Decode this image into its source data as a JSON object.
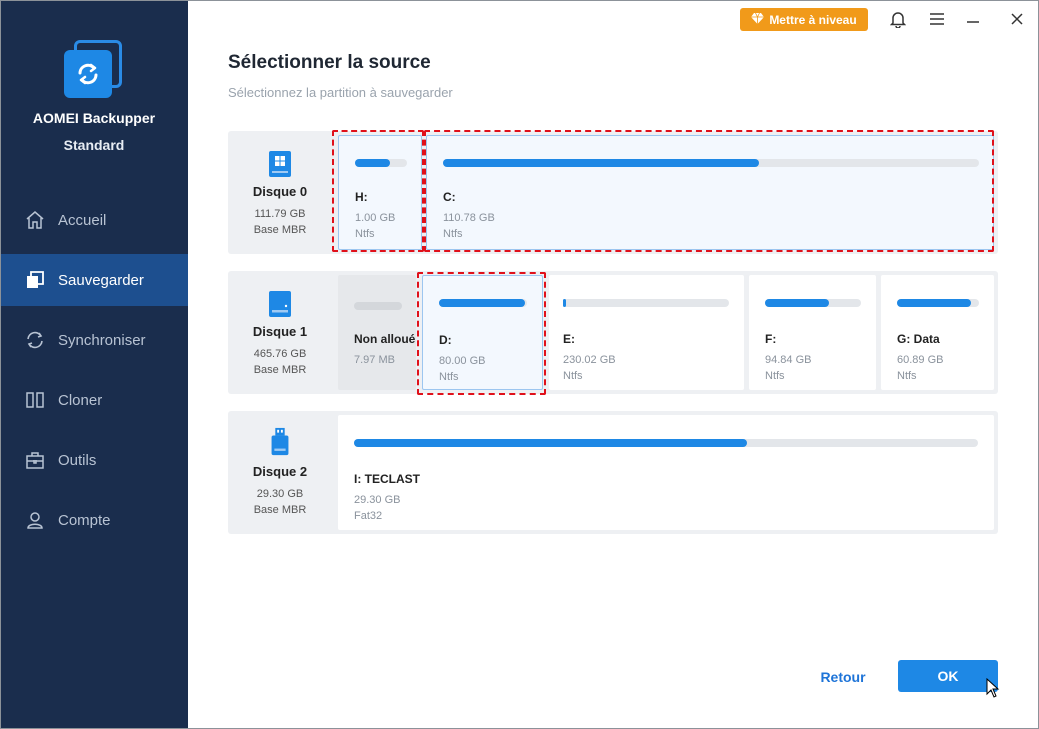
{
  "app": {
    "name": "AOMEI Backupper",
    "edition": "Standard"
  },
  "sidebar": {
    "items": [
      {
        "label": "Accueil",
        "icon": "home-icon"
      },
      {
        "label": "Sauvegarder",
        "icon": "backup-icon",
        "active": true
      },
      {
        "label": "Synchroniser",
        "icon": "sync-icon"
      },
      {
        "label": "Cloner",
        "icon": "clone-icon"
      },
      {
        "label": "Outils",
        "icon": "toolbox-icon"
      },
      {
        "label": "Compte",
        "icon": "user-icon"
      }
    ]
  },
  "topbar": {
    "upgrade_label": "Mettre à niveau"
  },
  "main": {
    "title": "Sélectionner la source",
    "subtitle": "Sélectionnez la partition à sauvegarder"
  },
  "disks": [
    {
      "name": "Disque 0",
      "size": "111.79 GB",
      "type": "Base MBR",
      "partitions": [
        {
          "label": "H:",
          "size": "1.00 GB",
          "fs": "Ntfs",
          "used": 0.67,
          "selected": true
        },
        {
          "label": "C:",
          "size": "110.78 GB",
          "fs": "Ntfs",
          "used": 0.59,
          "selected": true
        }
      ]
    },
    {
      "name": "Disque 1",
      "size": "465.76 GB",
      "type": "Base MBR",
      "partitions": [
        {
          "label": "Non alloué",
          "size": "7.97 MB",
          "fs": "",
          "used": 0,
          "unallocated": true
        },
        {
          "label": "D:",
          "size": "80.00 GB",
          "fs": "Ntfs",
          "used": 0.98,
          "selected": true
        },
        {
          "label": "E:",
          "size": "230.02 GB",
          "fs": "Ntfs",
          "used": 0.02
        },
        {
          "label": "F:",
          "size": "94.84 GB",
          "fs": "Ntfs",
          "used": 0.67
        },
        {
          "label": "G: Data",
          "size": "60.89 GB",
          "fs": "Ntfs",
          "used": 0.9
        }
      ]
    },
    {
      "name": "Disque 2",
      "size": "29.30 GB",
      "type": "Base MBR",
      "partitions": [
        {
          "label": "I: TECLAST",
          "size": "29.30 GB",
          "fs": "Fat32",
          "used": 0.63
        }
      ]
    }
  ],
  "footer": {
    "back_label": "Retour",
    "ok_label": "OK"
  },
  "colors": {
    "sidebar": "#1a2d4d",
    "sidebar_active": "#1d4f8f",
    "accent": "#1e88e5",
    "upgrade": "#f19a1a",
    "highlight": "#e0101a"
  }
}
